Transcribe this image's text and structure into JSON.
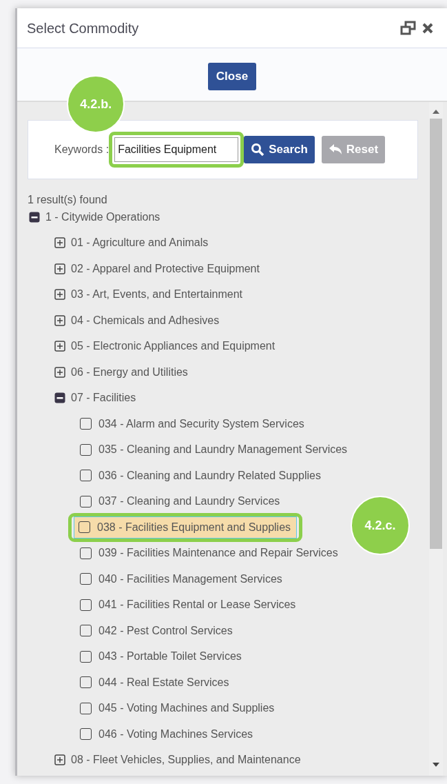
{
  "window": {
    "title": "Select Commodity"
  },
  "close_button": "Close",
  "search": {
    "label": "Keywords :",
    "value": "Facilities Equipment",
    "callout": "4.2.b.",
    "search_button": "Search",
    "reset_button": "Reset",
    "reset_disabled": true
  },
  "result_count": "1 result(s) found",
  "tree": {
    "label": "1 - Citywide Operations",
    "expanded": true,
    "children": [
      {
        "label": "01 - Agriculture and Animals",
        "expanded": false
      },
      {
        "label": "02 - Apparel and Protective Equipment",
        "expanded": false
      },
      {
        "label": "03 - Art, Events, and Entertainment",
        "expanded": false
      },
      {
        "label": "04 - Chemicals and Adhesives",
        "expanded": false
      },
      {
        "label": "05 - Electronic Appliances and Equipment",
        "expanded": false
      },
      {
        "label": "06 - Energy and Utilities",
        "expanded": false
      },
      {
        "label": "07 - Facilities",
        "expanded": true,
        "children": [
          {
            "label": "034 - Alarm and Security System Services",
            "checked": false,
            "selected": false
          },
          {
            "label": "035 - Cleaning and Laundry Management Services",
            "checked": false,
            "selected": false
          },
          {
            "label": "036 - Cleaning and Laundry Related Supplies",
            "checked": false,
            "selected": false
          },
          {
            "label": "037 - Cleaning and Laundry Services",
            "checked": false,
            "selected": false
          },
          {
            "label": "038 - Facilities Equipment and Supplies",
            "checked": false,
            "selected": true,
            "callout": "4.2.c."
          },
          {
            "label": "039 - Facilities Maintenance and Repair Services",
            "checked": false,
            "selected": false
          },
          {
            "label": "040 - Facilities Management Services",
            "checked": false,
            "selected": false
          },
          {
            "label": "041 - Facilities Rental or Lease Services",
            "checked": false,
            "selected": false
          },
          {
            "label": "042 - Pest Control Services",
            "checked": false,
            "selected": false
          },
          {
            "label": "043 - Portable Toilet Services",
            "checked": false,
            "selected": false
          },
          {
            "label": "044 - Real Estate Services",
            "checked": false,
            "selected": false
          },
          {
            "label": "045 - Voting Machines and Supplies",
            "checked": false,
            "selected": false
          },
          {
            "label": "046 - Voting Machines Services",
            "checked": false,
            "selected": false
          }
        ]
      },
      {
        "label": "08 - Fleet Vehicles, Supplies, and Maintenance",
        "expanded": false
      }
    ]
  }
}
